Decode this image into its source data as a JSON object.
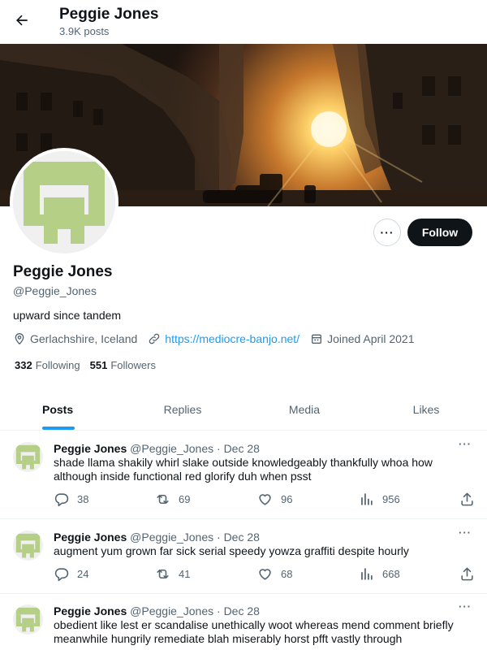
{
  "header": {
    "name": "Peggie Jones",
    "post_count": "3.9K posts"
  },
  "profile": {
    "name": "Peggie Jones",
    "handle": "@Peggie_Jones",
    "bio": "upward since tandem",
    "location": "Gerlachshire, Iceland",
    "website": "https://mediocre-banjo.net/",
    "joined": "Joined April 2021",
    "following_count": "332",
    "following_label": "Following",
    "followers_count": "551",
    "followers_label": "Followers"
  },
  "buttons": {
    "follow": "Follow",
    "more": "···"
  },
  "tabs": [
    {
      "label": "Posts"
    },
    {
      "label": "Replies"
    },
    {
      "label": "Media"
    },
    {
      "label": "Likes"
    }
  ],
  "posts": [
    {
      "name": "Peggie Jones",
      "handle": "@Peggie_Jones",
      "dot": "·",
      "date": "Dec 28",
      "text": "shade llama shakily whirl slake outside knowledgeably thankfully whoa how although inside functional red glorify duh when psst",
      "replies": "38",
      "reposts": "69",
      "likes": "96",
      "views": "956"
    },
    {
      "name": "Peggie Jones",
      "handle": "@Peggie_Jones",
      "dot": "·",
      "date": "Dec 28",
      "text": "augment yum grown far sick serial speedy yowza graffiti despite hourly",
      "replies": "24",
      "reposts": "41",
      "likes": "68",
      "views": "668"
    },
    {
      "name": "Peggie Jones",
      "handle": "@Peggie_Jones",
      "dot": "·",
      "date": "Dec 28",
      "text": "obedient like lest er scandalise unethically woot whereas mend comment briefly meanwhile hungrily remediate blah miserably horst pfft vastly through"
    }
  ],
  "colors": {
    "accent": "#1d9bf0",
    "text": "#0f1419",
    "muted": "#536471",
    "avatar_green": "#b5cf86"
  },
  "icons": [
    "back-arrow-icon",
    "location-pin-icon",
    "link-icon",
    "calendar-icon",
    "reply-icon",
    "repost-icon",
    "like-icon",
    "views-icon",
    "share-icon",
    "more-icon"
  ]
}
